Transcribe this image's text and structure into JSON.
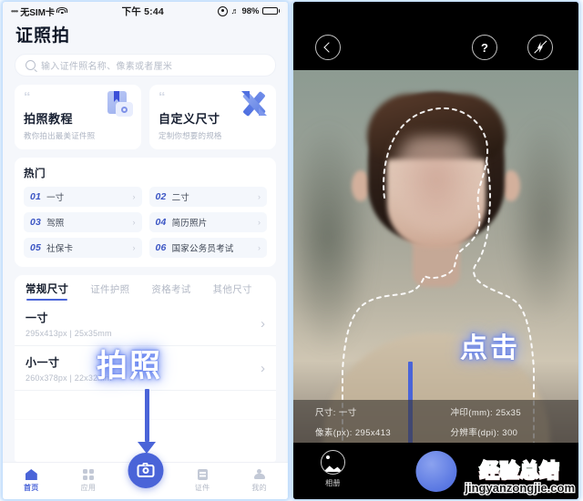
{
  "left_phone": {
    "status_bar": {
      "carrier": "无SIM卡",
      "wifi_icon": "wifi-icon",
      "time": "下午 5:44",
      "location_icon": "location-icon",
      "headphones_icon": "headphones-icon",
      "battery_percent": "98%",
      "battery_icon": "battery-icon"
    },
    "app_title": "证照拍",
    "search": {
      "placeholder": "输入证件照名称、像素或者厘米",
      "value": "",
      "icon": "search-icon"
    },
    "feature_cards": [
      {
        "quote": "“",
        "title": "拍照教程",
        "subtitle": "教你拍出最美证件照",
        "icon": "book-camera-icon"
      },
      {
        "quote": "“",
        "title": "自定义尺寸",
        "subtitle": "定制你想要的规格",
        "icon": "pencil-ruler-icon"
      }
    ],
    "hot_section": {
      "title": "热门",
      "items": [
        {
          "num": "01",
          "label": "一寸"
        },
        {
          "num": "02",
          "label": "二寸"
        },
        {
          "num": "03",
          "label": "驾照"
        },
        {
          "num": "04",
          "label": "简历照片"
        },
        {
          "num": "05",
          "label": "社保卡"
        },
        {
          "num": "06",
          "label": "国家公务员考试"
        }
      ],
      "chevron": "›"
    },
    "tabs": [
      {
        "label": "常规尺寸",
        "active": true
      },
      {
        "label": "证件护照",
        "active": false
      },
      {
        "label": "资格考试",
        "active": false
      },
      {
        "label": "其他尺寸",
        "active": false
      }
    ],
    "size_rows": [
      {
        "name": "一寸",
        "meta": "295x413px  |  25x35mm",
        "chevron": "›"
      },
      {
        "name": "小一寸",
        "meta": "260x378px  |  22x32mm",
        "chevron": "›"
      }
    ],
    "tab_bar": [
      {
        "label": "首页",
        "icon": "home-icon",
        "active": true
      },
      {
        "label": "应用",
        "icon": "grid-icon",
        "active": false
      },
      {
        "label": "证件",
        "icon": "document-icon",
        "active": false
      },
      {
        "label": "我的",
        "icon": "user-icon",
        "active": false
      }
    ],
    "fab": {
      "icon": "camera-icon",
      "color": "#4a64d8"
    },
    "overlay": {
      "text": "拍照",
      "arrow": "down-arrow-annotation"
    }
  },
  "right_phone": {
    "top_controls": [
      {
        "name": "back",
        "icon": "chevron-left-icon"
      },
      {
        "name": "help",
        "icon": "question-mark-icon"
      },
      {
        "name": "flash",
        "icon": "flash-off-icon"
      }
    ],
    "face_guide": "dashed-face-outline",
    "overlay": {
      "text": "点击",
      "arrow": "down-arrow-annotation"
    },
    "info": {
      "size_label": "尺寸: 一寸",
      "print_label": "冲印(mm): 25x35",
      "pixel_label": "像素(px): 295x413",
      "dpi_label": "分辨率(dpi): 300"
    },
    "album": {
      "label": "相册",
      "icon": "photo-icon"
    },
    "shutter": {
      "name": "shutter-button",
      "color": "#5a78e2"
    },
    "watermark": {
      "cn": "经验总结",
      "en": "jingyanzongjie.com"
    }
  },
  "theme": {
    "accent": "#4a64d8",
    "panel_glow": "#bfdcfb",
    "bg": "#f5f7fb"
  }
}
